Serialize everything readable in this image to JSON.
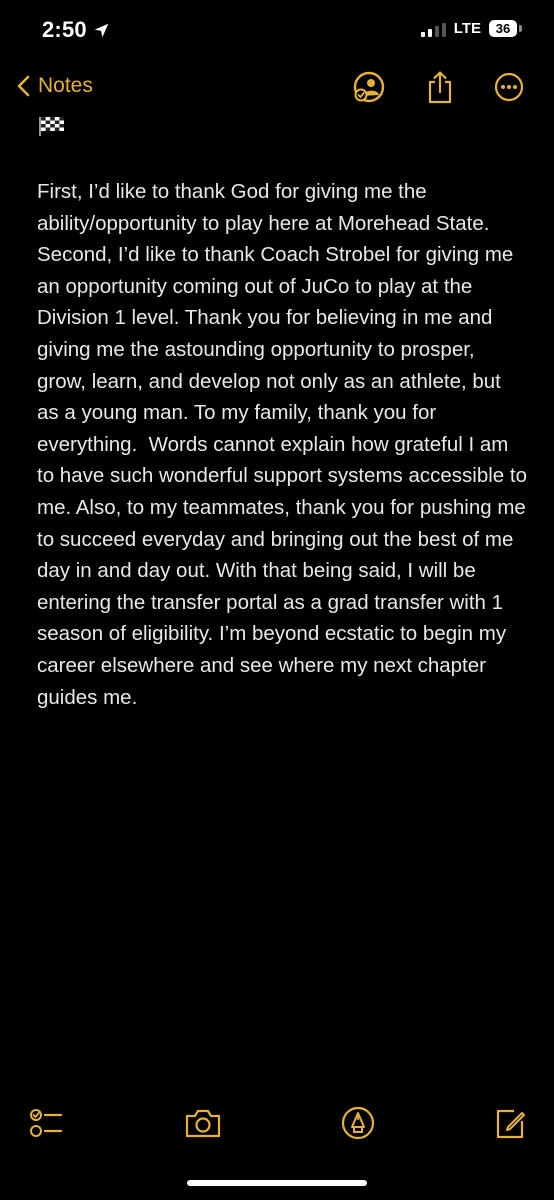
{
  "status_bar": {
    "time": "2:50",
    "carrier": "LTE",
    "battery": "36"
  },
  "nav": {
    "back_label": "Notes"
  },
  "note": {
    "body": "First, I’d like to thank God for giving me the ability/opportunity to play here at Morehead State. Second, I’d like to thank Coach Strobel for giving me an opportunity coming out of JuCo to play at the Division 1 level. Thank you for believing in me and giving me the astounding opportunity to prosper, grow, learn, and develop not only as an athlete, but as a young man. To my family, thank you for everything.  Words cannot explain how grateful I am to have such wonderful support systems accessible to me. Also, to my teammates, thank you for pushing me to succeed everyday and bringing out the best of me day in and day out. With that being said, I will be entering the transfer portal as a grad transfer with 1 season of eligibility. I’m beyond ecstatic to begin my career elsewhere and see where my next chapter guides me."
  },
  "colors": {
    "accent": "#e5b236",
    "background": "#000000",
    "text": "#e8e8e8"
  },
  "icons": {
    "status": [
      "location-arrow-icon",
      "signal-icon",
      "battery-icon"
    ],
    "nav": [
      "chevron-left-icon",
      "share-collaborate-icon",
      "share-icon",
      "more-icon"
    ],
    "toolbar": [
      "checklist-icon",
      "camera-icon",
      "markup-pen-icon",
      "compose-icon"
    ],
    "note": [
      "checkered-flag-icon"
    ]
  }
}
